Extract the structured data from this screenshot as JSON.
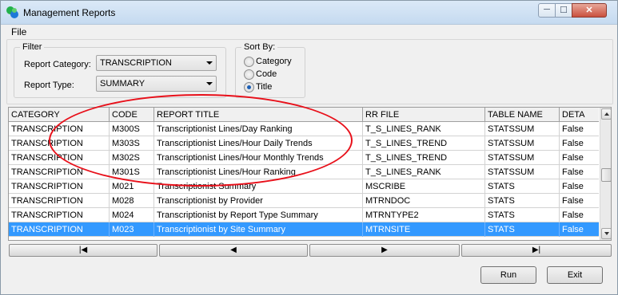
{
  "window": {
    "title": "Management Reports",
    "minimize_glyph": "─",
    "maximize_glyph": "☐",
    "close_glyph": "✕"
  },
  "menu": {
    "file": "File"
  },
  "filter": {
    "legend": "Filter",
    "category_label": "Report Category:",
    "category_value": "TRANSCRIPTION",
    "type_label": "Report Type:",
    "type_value": "SUMMARY"
  },
  "sort": {
    "legend": "Sort By:",
    "options": [
      "Category",
      "Code",
      "Title"
    ],
    "selected": "Title"
  },
  "grid": {
    "columns": [
      "CATEGORY",
      "CODE",
      "REPORT TITLE",
      "RR FILE",
      "TABLE NAME",
      "DETA"
    ],
    "rows": [
      [
        "TRANSCRIPTION",
        "M300S",
        "Transcriptionist Lines/Day Ranking",
        "T_S_LINES_RANK",
        "STATSSUM",
        "False"
      ],
      [
        "TRANSCRIPTION",
        "M303S",
        "Transcriptionist Lines/Hour Daily Trends",
        "T_S_LINES_TREND",
        "STATSSUM",
        "False"
      ],
      [
        "TRANSCRIPTION",
        "M302S",
        "Transcriptionist Lines/Hour Monthly Trends",
        "T_S_LINES_TREND",
        "STATSSUM",
        "False"
      ],
      [
        "TRANSCRIPTION",
        "M301S",
        "Transcriptionist Lines/Hour Ranking",
        "T_S_LINES_RANK",
        "STATSSUM",
        "False"
      ],
      [
        "TRANSCRIPTION",
        "M021",
        "Transcriptionist Summary",
        "MSCRIBE",
        "STATS",
        "False"
      ],
      [
        "TRANSCRIPTION",
        "M028",
        "Transcriptionist by Provider",
        "MTRNDOC",
        "STATS",
        "False"
      ],
      [
        "TRANSCRIPTION",
        "M024",
        "Transcriptionist by Report Type Summary",
        "MTRNTYPE2",
        "STATS",
        "False"
      ],
      [
        "TRANSCRIPTION",
        "M023",
        "Transcriptionist by Site Summary",
        "MTRNSITE",
        "STATS",
        "False"
      ]
    ],
    "selected_row": 7
  },
  "nav": {
    "first": "|◀",
    "prev": "◀",
    "next": "▶",
    "last": "▶|"
  },
  "buttons": {
    "run": "Run",
    "exit": "Exit"
  },
  "colors": {
    "selection": "#3399ff",
    "annotation": "#e8101a",
    "app_icon_green": "#22b14c",
    "app_icon_blue": "#1e78d8"
  }
}
